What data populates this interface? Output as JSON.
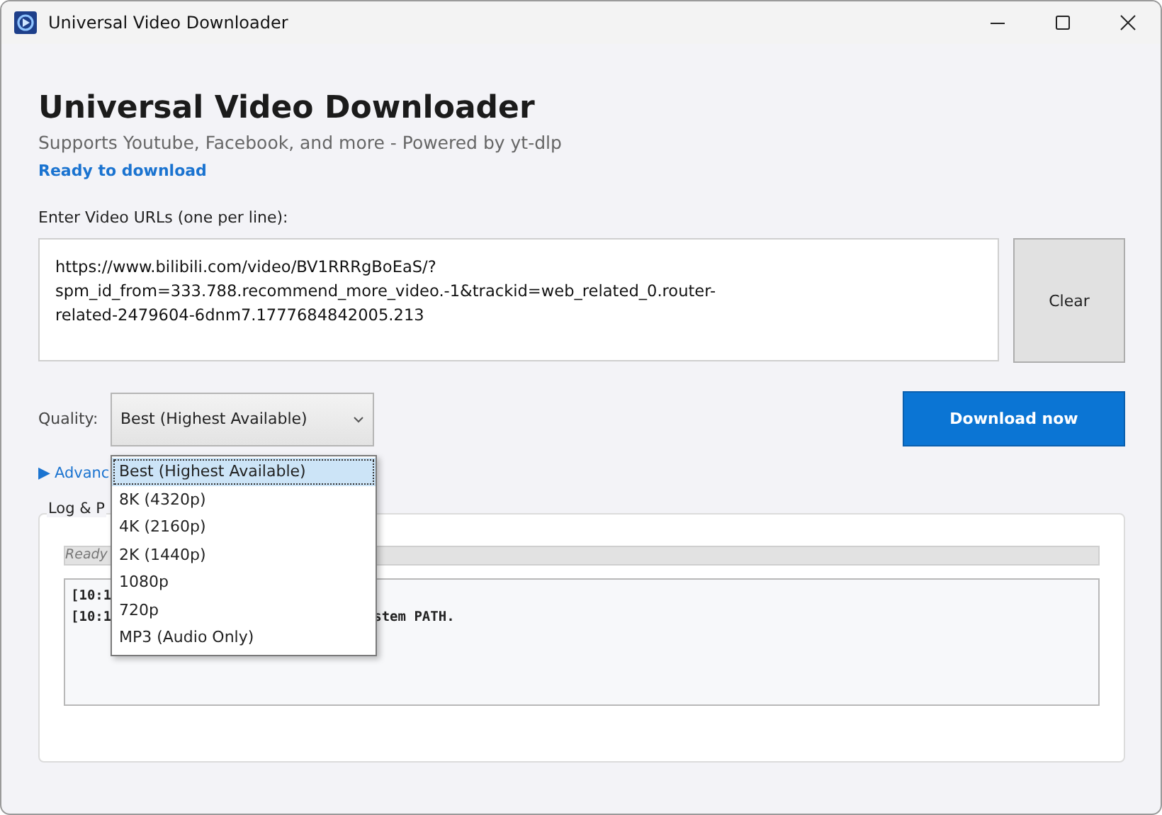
{
  "window": {
    "title": "Universal Video Downloader"
  },
  "header": {
    "title": "Universal Video Downloader",
    "subtitle": "Supports Youtube, Facebook, and more - Powered by yt-dlp",
    "status": "Ready to download"
  },
  "urls": {
    "label": "Enter Video URLs (one per line):",
    "value": "https://www.bilibili.com/video/BV1RRRgBoEaS/?\nspm_id_from=333.788.recommend_more_video.-1&trackid=web_related_0.router-\nrelated-2479604-6dnm7.1777684842005.213"
  },
  "clear_button": "Clear",
  "quality": {
    "label": "Quality:",
    "value": "Best (Highest Available)",
    "expanded": true,
    "options": [
      {
        "label": "Best (Highest Available)",
        "selected": true
      },
      {
        "label": "8K (4320p)",
        "selected": false
      },
      {
        "label": "4K (2160p)",
        "selected": false
      },
      {
        "label": "2K (1440p)",
        "selected": false
      },
      {
        "label": "1080p",
        "selected": false
      },
      {
        "label": "720p",
        "selected": false
      },
      {
        "label": "MP3 (Audio Only)",
        "selected": false
      }
    ]
  },
  "download_button": "Download now",
  "advanced": {
    "icon": "▶",
    "label": "Advanc"
  },
  "log": {
    "title": "Log & P",
    "progress": {
      "text": "Ready",
      "level": 0
    },
    "lines": [
      {
        "left": "[10:1"
      },
      {
        "left": "[10:1",
        "right": "stem PATH."
      }
    ]
  }
}
